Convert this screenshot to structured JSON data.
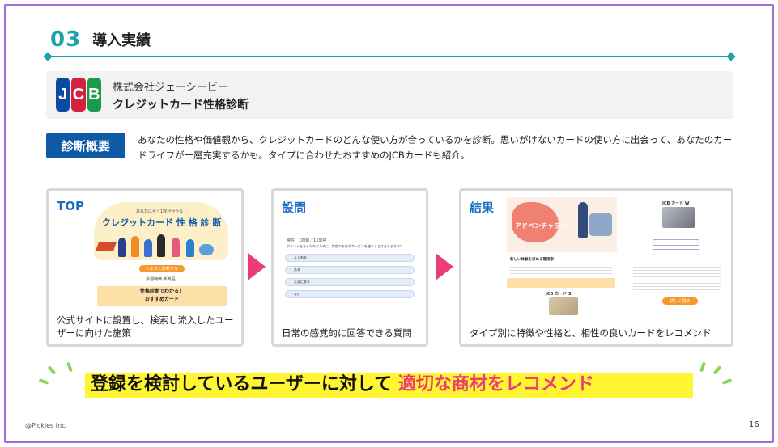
{
  "header": {
    "number": "03",
    "title": "導入実績"
  },
  "client": {
    "company": "株式会社ジェーシービー",
    "product": "クレジットカード性格診断",
    "logo_letters": [
      "J",
      "C",
      "B"
    ]
  },
  "overview": {
    "badge": "診断概要",
    "text": "あなたの性格や価値観から、クレジットカードのどんな使い方が合っているかを診断。思いがけないカードの使い方に出会って、あなたのカードライフが一層充実するかも。タイプに合わせたおすすめのJCBカードも紹介。"
  },
  "cards": [
    {
      "label": "TOP",
      "caption": "公式サイトに設置し、検索し流入したユーザーに向けた施策",
      "shot": {
        "small_header": "あなたに合う1枚が分かる",
        "title": "クレジットカード 性 格 診 断",
        "button": "いますぐ診断する",
        "chip": "今週特価 新商品",
        "box_line1": "性格診断でわかる！",
        "box_line2": "おすすめカード"
      }
    },
    {
      "label": "設問",
      "caption": "日常の感覚的に回答できる質問",
      "shot": {
        "progress": "現在　1問目／11問中",
        "question": "ポイントをあらためるために、特定のお店やサービスを使うことはありますか？",
        "options": [
          "よくある",
          "ある",
          "たまにある",
          "ない"
        ]
      }
    },
    {
      "label": "結果",
      "caption": "タイプ別に特徴や性格と、相性の良いカードをレコメンド",
      "shot": {
        "type_title": "アドベンチャラー",
        "section": "新しい体験を求める冒険家",
        "card1": "JCB カード S",
        "card2": "JCB カード W",
        "button": "詳しく見る"
      }
    }
  ],
  "bottom": {
    "message": "登録を検討しているユーザーに対して",
    "highlight": "適切な商材をレコメンド"
  },
  "footer": {
    "copyright": "@Pickles Inc.",
    "page": "16"
  },
  "colors": {
    "teal": "#1aa3a8",
    "blue": "#0e5aa7",
    "pink": "#e93d74",
    "yellow": "#fff533",
    "frame": "#9d6fd6"
  }
}
